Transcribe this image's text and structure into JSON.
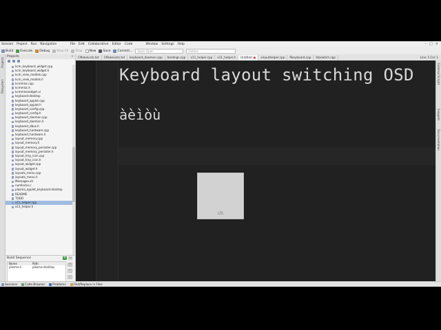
{
  "menu": [
    "Session",
    "Project",
    "Run",
    "Navigation",
    "File",
    "Edit",
    "Collaborative",
    "Editor",
    "Code",
    "Window",
    "Settings",
    "Help"
  ],
  "toolbar": {
    "build": "Build",
    "execute": "Execute",
    "debug": "Debug",
    "stop_all": "Stop All",
    "stop": "Stop",
    "new": "New",
    "save": "Save",
    "commit": "Commit...",
    "quick_open_placeholder": "Quick Open",
    "outline_placeholder": "Outline"
  },
  "tabs": [
    {
      "label": "CMakeLists.txt",
      "active": false
    },
    {
      "label": "CMakeLists.txt",
      "active": false
    },
    {
      "label": "keyboard_daemon.cpp",
      "active": false
    },
    {
      "label": "bindings.cpp",
      "active": false
    },
    {
      "label": "x11_helper.cpp",
      "active": false
    },
    {
      "label": "x11_helper.h",
      "active": false
    },
    {
      "label": "Untitled",
      "active": true
    },
    {
      "label": "xinputhelper.cpp",
      "active": false
    },
    {
      "label": "flkeyboard.cpp",
      "active": false
    },
    {
      "label": "lkbswitch.cpp",
      "active": false
    }
  ],
  "line_col": "Line: 5 Col: 1",
  "left_panels": [
    "Projects",
    "Filesystem"
  ],
  "right_panels": [
    "External Scripts",
    "Snippets",
    "Documentation"
  ],
  "projects": {
    "title": "Projects",
    "files": [
      "kcm_keyboard_widget.cpp",
      "kcm_keyboard_widget.h",
      "kcm_view_models.cpp",
      "kcm_view_models.h",
      "kcmmisc.cpp",
      "kcmmisc.h",
      "kcmmiscwidget.ui",
      "keyboard.desktop",
      "keyboard_applet.cpp",
      "keyboard_applet.h",
      "keyboard_config.cpp",
      "keyboard_config.h",
      "keyboard_daemon.cpp",
      "keyboard_daemon.h",
      "keyboard_dbus.h",
      "keyboard_hardware.cpp",
      "keyboard_hardware.h",
      "layout_memory.cpp",
      "layout_memory.h",
      "layout_memory_persister.cpp",
      "layout_memory_persister.h",
      "layout_tray_icon.cpp",
      "layout_tray_icon.h",
      "layout_widget.cpp",
      "layout_widget.h",
      "layouts_menu.cpp",
      "layouts_menu.h",
      "Messages.sh",
      "numlockx.c",
      "plasma_applet_keyboard.desktop",
      "README",
      "TODO",
      "x11_helper.cpp",
      "x11_helper.h"
    ],
    "selected_index": 32
  },
  "build_sequence": {
    "title": "Build Sequence",
    "columns": [
      "Name",
      "Path"
    ],
    "rows": [
      [
        "plasma-ii",
        "plasma-desktop"
      ]
    ]
  },
  "editor": {
    "heading": "Keyboard layout switching OSD",
    "chars": "àèìòù"
  },
  "osd": {
    "label": "US"
  },
  "statusbar": [
    "Sessions",
    "Code Browser",
    "Problems",
    "Find/Replace in Files"
  ]
}
